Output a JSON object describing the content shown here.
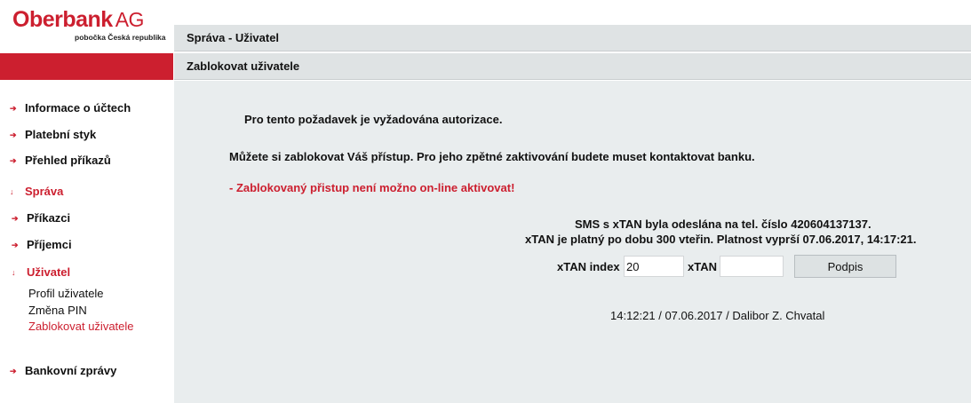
{
  "brand": {
    "name": "Oberbank",
    "suffix": "AG",
    "subtitle": "pobočka Česká republika",
    "color": "#cc1f2f"
  },
  "header": {
    "breadcrumb": "Správa - Uživatel",
    "page_title": "Zablokovat uživatele"
  },
  "sidebar": {
    "items": [
      {
        "label": "Informace o účtech",
        "icon": "arrow-right-icon",
        "active": false
      },
      {
        "label": "Platební styk",
        "icon": "arrow-right-icon",
        "active": false
      },
      {
        "label": "Přehled příkazů",
        "icon": "arrow-right-icon",
        "active": false
      },
      {
        "label": "Správa",
        "icon": "arrow-down-icon",
        "active": true
      },
      {
        "label": "Příkazci",
        "icon": "arrow-right-icon",
        "active": false
      },
      {
        "label": "Příjemci",
        "icon": "arrow-right-icon",
        "active": false
      },
      {
        "label": "Uživatel",
        "icon": "arrow-down-icon",
        "active": true
      },
      {
        "label": "Bankovní zprávy",
        "icon": "arrow-right-icon",
        "active": false
      }
    ],
    "subitems": [
      {
        "label": "Profil uživatele",
        "active": false
      },
      {
        "label": "Změna PIN",
        "active": false
      },
      {
        "label": "Zablokovat uživatele",
        "active": true
      }
    ]
  },
  "main": {
    "auth_notice": "Pro tento požadavek je vyžadována autorizace.",
    "block_info": "Můžete si zablokovat Váš přístup. Pro jeho zpětné zaktivování budete muset kontaktovat banku.",
    "warning": "- Zablokovaný přistup není možno on-line aktivovat!",
    "sms_line1": "SMS s xTAN byla odeslána na tel. číslo 420604137137.",
    "sms_line2": "xTAN je platný po dobu 300 vteřin. Platnost vyprší 07.06.2017, 14:17:21.",
    "xtan_index_label": "xTAN index",
    "xtan_index_value": "20",
    "xtan_label": "xTAN",
    "xtan_value": "",
    "sign_button": "Podpis",
    "footer": "14:12:21  /  07.06.2017  /  Dalibor Z. Chvatal"
  }
}
